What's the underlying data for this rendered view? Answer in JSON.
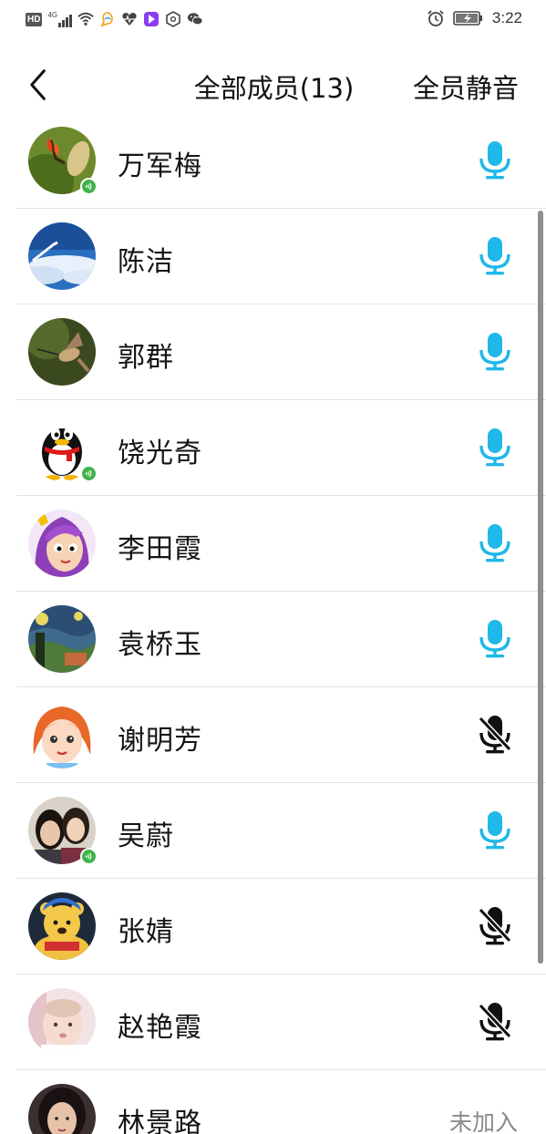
{
  "status_bar": {
    "left_icons": [
      "hd-icon",
      "signal-4g-icon",
      "wifi-icon",
      "app-notification-icon",
      "health-icon",
      "video-app-icon",
      "hexagon-app-icon",
      "wechat-icon"
    ],
    "hd_label": "HD",
    "net_label": "4G",
    "time": "3:22"
  },
  "header": {
    "title": "全部成员(13)",
    "mute_all_label": "全员静音"
  },
  "colors": {
    "mic_on": "#1fb8e8",
    "mic_off": "#111111",
    "speaking_badge": "#3fb24a"
  },
  "members": [
    {
      "name": "万军梅",
      "avatar": "flower-photo-avatar",
      "speaking": true,
      "mic": "on"
    },
    {
      "name": "陈洁",
      "avatar": "sky-clouds-avatar",
      "speaking": false,
      "mic": "on"
    },
    {
      "name": "郭群",
      "avatar": "hummingbird-avatar",
      "speaking": false,
      "mic": "on"
    },
    {
      "name": "饶光奇",
      "avatar": "qq-penguin-avatar",
      "speaking": true,
      "mic": "on"
    },
    {
      "name": "李田霞",
      "avatar": "cartoon-girl-purple-hair-avatar",
      "speaking": false,
      "mic": "on"
    },
    {
      "name": "袁桥玉",
      "avatar": "starry-night-painting-avatar",
      "speaking": false,
      "mic": "on"
    },
    {
      "name": "谢明芳",
      "avatar": "cartoon-girl-orange-hair-avatar",
      "speaking": false,
      "mic": "off"
    },
    {
      "name": "吴蔚",
      "avatar": "two-people-photo-avatar",
      "speaking": true,
      "mic": "on"
    },
    {
      "name": "张婧",
      "avatar": "winnie-bear-avatar",
      "speaking": false,
      "mic": "off"
    },
    {
      "name": "赵艳霞",
      "avatar": "baby-photo-avatar",
      "speaking": false,
      "mic": "off"
    },
    {
      "name": "林景路",
      "avatar": "woman-photo-avatar",
      "speaking": false,
      "mic": "none",
      "status_text": "未加入"
    }
  ]
}
